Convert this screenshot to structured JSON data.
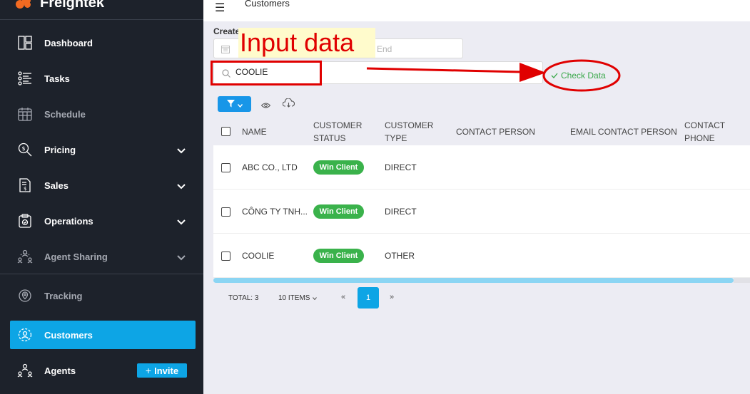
{
  "app": {
    "brand": "Freightek"
  },
  "topbar": {
    "title": "Customers"
  },
  "sidebar": {
    "items": [
      {
        "label": "Dashboard"
      },
      {
        "label": "Tasks"
      },
      {
        "label": "Schedule"
      },
      {
        "label": "Pricing"
      },
      {
        "label": "Sales"
      },
      {
        "label": "Operations"
      },
      {
        "label": "Agent Sharing"
      },
      {
        "label": "Tracking"
      },
      {
        "label": "Customers"
      },
      {
        "label": "Agents"
      }
    ],
    "invite_label": "Invite"
  },
  "filters": {
    "created_label": "Created On:",
    "end_placeholder": "End",
    "search_value": "COOLIE",
    "check_label": "Check Data"
  },
  "table": {
    "columns": [
      "NAME",
      "CUSTOMER STATUS",
      "CUSTOMER TYPE",
      "CONTACT PERSON",
      "EMAIL CONTACT PERSON",
      "CONTACT PHONE"
    ],
    "column_lines": [
      [
        "NAME",
        ""
      ],
      [
        "CUSTOMER",
        "STATUS"
      ],
      [
        "CUSTOMER",
        "TYPE"
      ],
      [
        "CONTACT PERSON",
        ""
      ],
      [
        "EMAIL CONTACT PERSON",
        ""
      ],
      [
        "CONTACT",
        "PHONE"
      ]
    ],
    "rows": [
      {
        "name": "ABC CO., LTD",
        "status": "Win Client",
        "type": "DIRECT"
      },
      {
        "name": "CÔNG TY TNH...",
        "status": "Win Client",
        "type": "DIRECT"
      },
      {
        "name": "COOLIE",
        "status": "Win Client",
        "type": "OTHER"
      }
    ]
  },
  "pagination": {
    "total": "TOTAL: 3",
    "per_page": "10 ITEMS",
    "prev": "«",
    "current": "1",
    "next": "»"
  },
  "annotation": {
    "label": "Input data"
  },
  "colors": {
    "sidebar_bg": "#1d222b",
    "accent": "#0da5e5",
    "success": "#3ab24b",
    "annotation": "#e00000"
  }
}
